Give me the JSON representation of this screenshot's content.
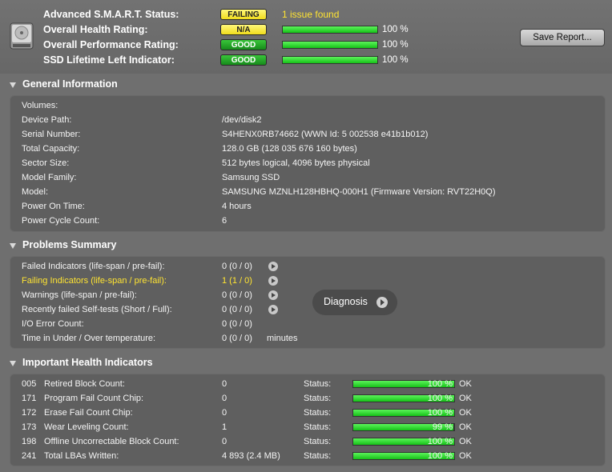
{
  "header": {
    "rows": [
      {
        "label": "Advanced S.M.A.R.T. Status:",
        "badge": "FAILING",
        "badge_color": "yellow",
        "text": "1 issue found"
      },
      {
        "label": "Overall Health Rating:",
        "badge": "N/A",
        "badge_color": "yellow",
        "progress": 1.0,
        "pct": "100 %"
      },
      {
        "label": "Overall Performance Rating:",
        "badge": "GOOD",
        "badge_color": "green",
        "progress": 1.0,
        "pct": "100 %"
      },
      {
        "label": "SSD Lifetime Left Indicator:",
        "badge": "GOOD",
        "badge_color": "green",
        "progress": 1.0,
        "pct": "100 %"
      }
    ],
    "save_report_label": "Save Report..."
  },
  "general": {
    "title": "General Information",
    "rows": [
      {
        "label": "Volumes:",
        "value": ""
      },
      {
        "label": "Device Path:",
        "value": "/dev/disk2"
      },
      {
        "label": "Serial Number:",
        "value": "S4HENX0RB74662 (WWN Id: 5 002538 e41b1b012)"
      },
      {
        "label": "Total Capacity:",
        "value": "128.0 GB (128 035 676 160 bytes)"
      },
      {
        "label": "Sector Size:",
        "value": "512 bytes logical, 4096 bytes physical"
      },
      {
        "label": "Model Family:",
        "value": "Samsung SSD"
      },
      {
        "label": "Model:",
        "value": "SAMSUNG MZNLH128HBHQ-000H1  (Firmware Version: RVT22H0Q)"
      },
      {
        "label": "Power On Time:",
        "value": "4 hours"
      },
      {
        "label": "Power Cycle Count:",
        "value": "6"
      }
    ]
  },
  "problems": {
    "title": "Problems Summary",
    "rows": [
      {
        "label": "Failed Indicators (life-span / pre-fail):",
        "value": "0 (0 / 0)",
        "arrow": true,
        "highlight": false,
        "suffix": ""
      },
      {
        "label": "Failing Indicators (life-span / pre-fail):",
        "value": "1 (1 / 0)",
        "arrow": true,
        "highlight": true,
        "suffix": ""
      },
      {
        "label": "Warnings (life-span / pre-fail):",
        "value": "0 (0 / 0)",
        "arrow": true,
        "highlight": false,
        "suffix": ""
      },
      {
        "label": "Recently failed Self-tests (Short / Full):",
        "value": "0 (0 / 0)",
        "arrow": true,
        "highlight": false,
        "suffix": ""
      },
      {
        "label": "I/O Error Count:",
        "value": "0 (0 / 0)",
        "arrow": false,
        "highlight": false,
        "suffix": ""
      },
      {
        "label": "Time in Under / Over temperature:",
        "value": "0 (0 / 0)",
        "arrow": false,
        "highlight": false,
        "suffix": "minutes"
      }
    ],
    "diagnosis_label": "Diagnosis"
  },
  "health": {
    "title": "Important Health Indicators",
    "status_label": "Status:",
    "rows": [
      {
        "id": "005",
        "name": "Retired Block Count:",
        "value": "0",
        "progress": 1.0,
        "pct": "100 %",
        "state": "OK"
      },
      {
        "id": "171",
        "name": "Program Fail Count Chip:",
        "value": "0",
        "progress": 1.0,
        "pct": "100 %",
        "state": "OK"
      },
      {
        "id": "172",
        "name": "Erase Fail Count Chip:",
        "value": "0",
        "progress": 1.0,
        "pct": "100 %",
        "state": "OK"
      },
      {
        "id": "173",
        "name": "Wear Leveling Count:",
        "value": "1",
        "progress": 0.99,
        "pct": "99 %",
        "state": "OK"
      },
      {
        "id": "198",
        "name": "Offline Uncorrectable Block Count:",
        "value": "0",
        "progress": 1.0,
        "pct": "100 %",
        "state": "OK"
      },
      {
        "id": "241",
        "name": "Total LBAs Written:",
        "value": "4 893 (2.4 MB)",
        "progress": 1.0,
        "pct": "100 %",
        "state": "OK"
      }
    ]
  }
}
